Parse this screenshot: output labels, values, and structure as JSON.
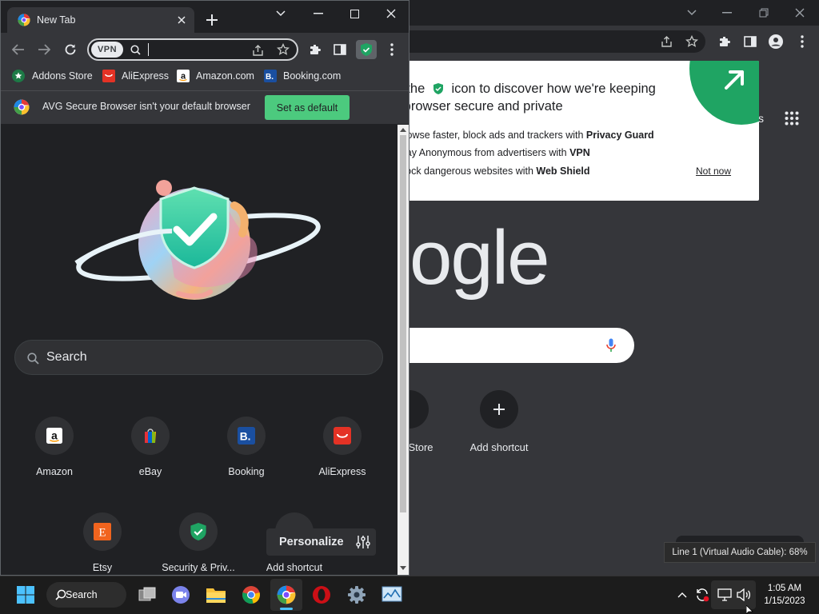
{
  "background_window": {
    "logo_fragment": "ogle",
    "shortcuts": [
      {
        "label": "Store"
      },
      {
        "label": "Add shortcut"
      }
    ],
    "apps_fragment": "s"
  },
  "popup": {
    "title_part1": "Click the",
    "title_part2": "icon to discover how we're keeping your browser secure and private",
    "items": [
      {
        "text": "Browse faster, block ads and trackers with ",
        "bold": "Privacy Guard"
      },
      {
        "text": "Stay Anonymous from advertisers with ",
        "bold": "VPN"
      },
      {
        "text": "Block dangerous websites with ",
        "bold": "Web Shield"
      }
    ],
    "not_now": "Not now",
    "accent_color": "#1fa463"
  },
  "window": {
    "tab_title": "New Tab",
    "vpn_label": "VPN",
    "bookmarks": [
      {
        "label": "Addons Store",
        "icon": "addons-store-icon"
      },
      {
        "label": "AliExpress",
        "icon": "aliexpress-icon"
      },
      {
        "label": "Amazon.com",
        "icon": "amazon-icon"
      },
      {
        "label": "Booking.com",
        "icon": "booking-icon"
      }
    ],
    "infobar": {
      "message": "AVG Secure Browser isn't your default browser",
      "button": "Set as default",
      "button_color": "#4cca7e"
    },
    "search_placeholder": "Search",
    "shortcuts": [
      {
        "label": "Amazon",
        "icon": "amazon-icon"
      },
      {
        "label": "eBay",
        "icon": "ebay-icon"
      },
      {
        "label": "Booking",
        "icon": "booking-icon"
      },
      {
        "label": "AliExpress",
        "icon": "aliexpress-icon"
      },
      {
        "label": "Etsy",
        "icon": "etsy-icon"
      },
      {
        "label": "Security & Priv...",
        "icon": "shield-icon"
      },
      {
        "label": "Add shortcut",
        "icon": "plus-icon"
      }
    ],
    "personalize_label": "Personalize"
  },
  "volume_tooltip": "Line 1 (Virtual Audio Cable): 68%",
  "taskbar": {
    "search_label": "Search",
    "time": "1:05 AM",
    "date": "1/15/2023"
  }
}
